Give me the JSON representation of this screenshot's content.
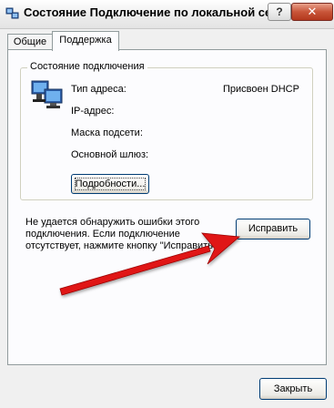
{
  "window": {
    "title": "Состояние Подключение по локальной сети",
    "help_button": "?",
    "close_glyph": "✕",
    "icon": "network-connection-icon"
  },
  "tabs": [
    {
      "label": "Общие",
      "selected": false
    },
    {
      "label": "Поддержка",
      "selected": true
    }
  ],
  "connection_status": {
    "legend": "Состояние подключения",
    "icon": "network-computer-icon",
    "rows": [
      {
        "label": "Тип адреса:",
        "value": "Присвоен DHCP"
      },
      {
        "label": "IP-адрес:",
        "value": ""
      },
      {
        "label": "Маска подсети:",
        "value": ""
      },
      {
        "label": "Основной шлюз:",
        "value": ""
      }
    ],
    "details_button": "Подробности..."
  },
  "repair": {
    "message_lines": [
      "Не удается обнаружить ошибки этого",
      "подключения. Если подключение",
      "отсутствует, нажмите кнопку \"Исправить\"."
    ],
    "button": "Исправить"
  },
  "footer": {
    "close_button": "Закрыть"
  },
  "annotation": {
    "color": "#e01818",
    "type": "arrow-pointing-to-repair-button"
  }
}
